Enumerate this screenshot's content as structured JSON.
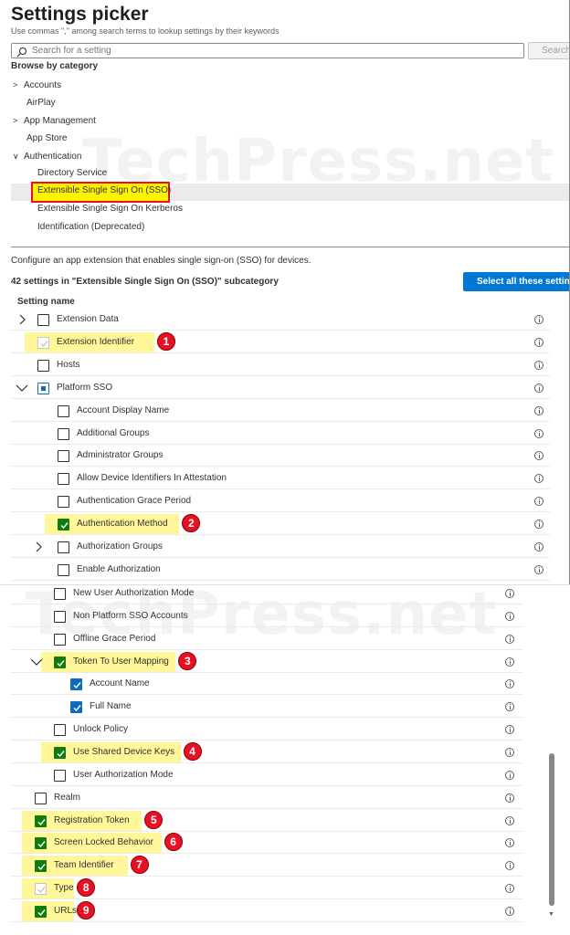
{
  "header": {
    "title": "Settings picker",
    "subtitle": "Use commas \",\" among search terms to lookup settings by their keywords"
  },
  "search": {
    "placeholder": "Search for a setting",
    "button_label": "Search"
  },
  "browse": {
    "label": "Browse by category",
    "categories": [
      {
        "label": "Accounts",
        "chevron": "right"
      },
      {
        "label": "AirPlay",
        "chevron": ""
      },
      {
        "label": "App Management",
        "chevron": "right"
      },
      {
        "label": "App Store",
        "chevron": ""
      },
      {
        "label": "Authentication",
        "chevron": "down"
      }
    ],
    "subcategories": [
      {
        "label": "Directory Service"
      },
      {
        "label": "Extensible Single Sign On (SSO)",
        "selected": true
      },
      {
        "label": "Extensible Single Sign On Kerberos"
      },
      {
        "label": "Identification (Deprecated)"
      }
    ]
  },
  "details": {
    "description": "Configure an app extension that enables single sign-on (SSO) for devices.",
    "count_label": "42 settings in \"Extensible Single Sign On (SSO)\" subcategory",
    "select_all_label": "Select all these setting",
    "column_header": "Setting name"
  },
  "watermark": "TechPress.net",
  "settings_top": [
    {
      "label": "Extension Data",
      "state": "unchecked",
      "chevron": "right",
      "indent": 0
    },
    {
      "label": "Extension Identifier",
      "state": "checked-gray",
      "chevron": "",
      "indent": 0,
      "highlight": true,
      "badge": "1"
    },
    {
      "label": "Hosts",
      "state": "unchecked",
      "chevron": "",
      "indent": 0
    },
    {
      "label": "Platform SSO",
      "state": "partial",
      "chevron": "down",
      "indent": 0
    },
    {
      "label": "Account Display Name",
      "state": "unchecked",
      "chevron": "",
      "indent": 1
    },
    {
      "label": "Additional Groups",
      "state": "unchecked",
      "chevron": "",
      "indent": 1
    },
    {
      "label": "Administrator Groups",
      "state": "unchecked",
      "chevron": "",
      "indent": 1
    },
    {
      "label": "Allow Device Identifiers In Attestation",
      "state": "unchecked",
      "chevron": "",
      "indent": 1
    },
    {
      "label": "Authentication Grace Period",
      "state": "unchecked",
      "chevron": "",
      "indent": 1
    },
    {
      "label": "Authentication Method",
      "state": "checked-green",
      "chevron": "",
      "indent": 1,
      "highlight": true,
      "badge": "2"
    },
    {
      "label": "Authorization Groups",
      "state": "unchecked",
      "chevron": "right",
      "indent": 1
    },
    {
      "label": "Enable Authorization",
      "state": "unchecked",
      "chevron": "",
      "indent": 1
    }
  ],
  "settings_bottom": [
    {
      "label": "New User Authorization Mode",
      "state": "unchecked",
      "chevron": "",
      "indent": 1
    },
    {
      "label": "Non Platform SSO Accounts",
      "state": "unchecked",
      "chevron": "",
      "indent": 1
    },
    {
      "label": "Offline Grace Period",
      "state": "unchecked",
      "chevron": "",
      "indent": 1
    },
    {
      "label": "Token To User Mapping",
      "state": "checked-green",
      "chevron": "down",
      "indent": 1,
      "highlight": true,
      "badge": "3"
    },
    {
      "label": "Account Name",
      "state": "checked",
      "chevron": "",
      "indent": 2
    },
    {
      "label": "Full Name",
      "state": "checked",
      "chevron": "",
      "indent": 2
    },
    {
      "label": "Unlock Policy",
      "state": "unchecked",
      "chevron": "",
      "indent": 1
    },
    {
      "label": "Use Shared Device Keys",
      "state": "checked-green",
      "chevron": "",
      "indent": 1,
      "highlight": true,
      "badge": "4"
    },
    {
      "label": "User Authorization Mode",
      "state": "unchecked",
      "chevron": "",
      "indent": 1
    },
    {
      "label": "Realm",
      "state": "unchecked",
      "chevron": "",
      "indent": 0
    },
    {
      "label": "Registration Token",
      "state": "checked-green",
      "chevron": "",
      "indent": 0,
      "highlight": true,
      "badge": "5"
    },
    {
      "label": "Screen Locked Behavior",
      "state": "checked-green",
      "chevron": "",
      "indent": 0,
      "highlight": true,
      "badge": "6"
    },
    {
      "label": "Team Identifier",
      "state": "checked-green",
      "chevron": "",
      "indent": 0,
      "highlight": true,
      "badge": "7"
    },
    {
      "label": "Type",
      "state": "checked-gray",
      "chevron": "",
      "indent": 0,
      "highlight": true,
      "badge": "8"
    },
    {
      "label": "URLs",
      "state": "checked-green",
      "chevron": "",
      "indent": 0,
      "highlight": true,
      "badge": "9"
    }
  ]
}
